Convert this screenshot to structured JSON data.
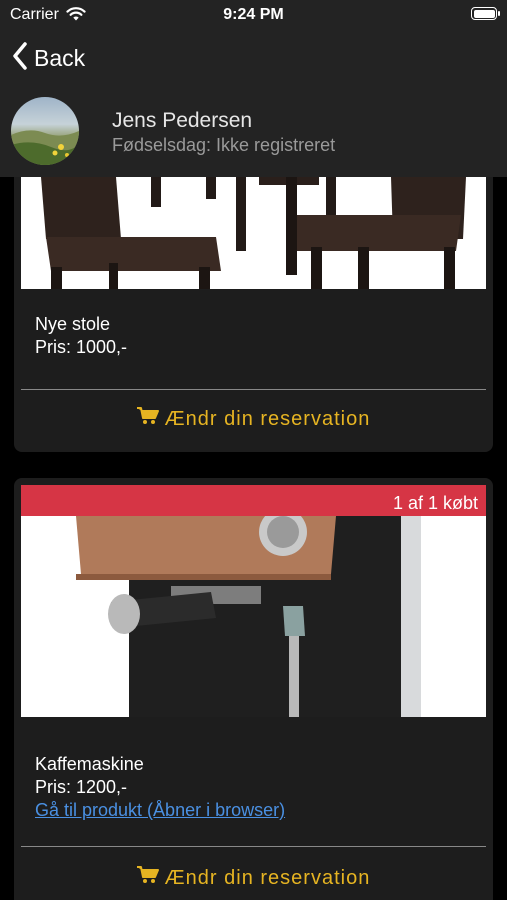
{
  "status_bar": {
    "carrier": "Carrier",
    "time": "9:24 PM",
    "battery_level": 1.0
  },
  "nav": {
    "back_label": "Back",
    "back_icon": "chevron-left-icon"
  },
  "profile": {
    "name": "Jens Pedersen",
    "birthday": "Fødselsdag: Ikke registreret"
  },
  "reservations": [
    {
      "image": "chairs-photo",
      "name": "Nye stole",
      "price": "Pris: 1000,-",
      "action_label": "Ændr din reservation"
    },
    {
      "image": "coffee-machine-photo",
      "badge": "1 af 1 købt",
      "name": "Kaffemaskine",
      "price": "Pris: 1200,-",
      "link_label": "Gå til produkt (Åbner i browser)",
      "action_label": "Ændr din reservation"
    }
  ],
  "colors": {
    "accent": "#e6b422",
    "badge_red": "#d63545",
    "link_blue": "#4a90e2",
    "card_bg": "#1d1d1d",
    "bar_bg": "#232323"
  }
}
